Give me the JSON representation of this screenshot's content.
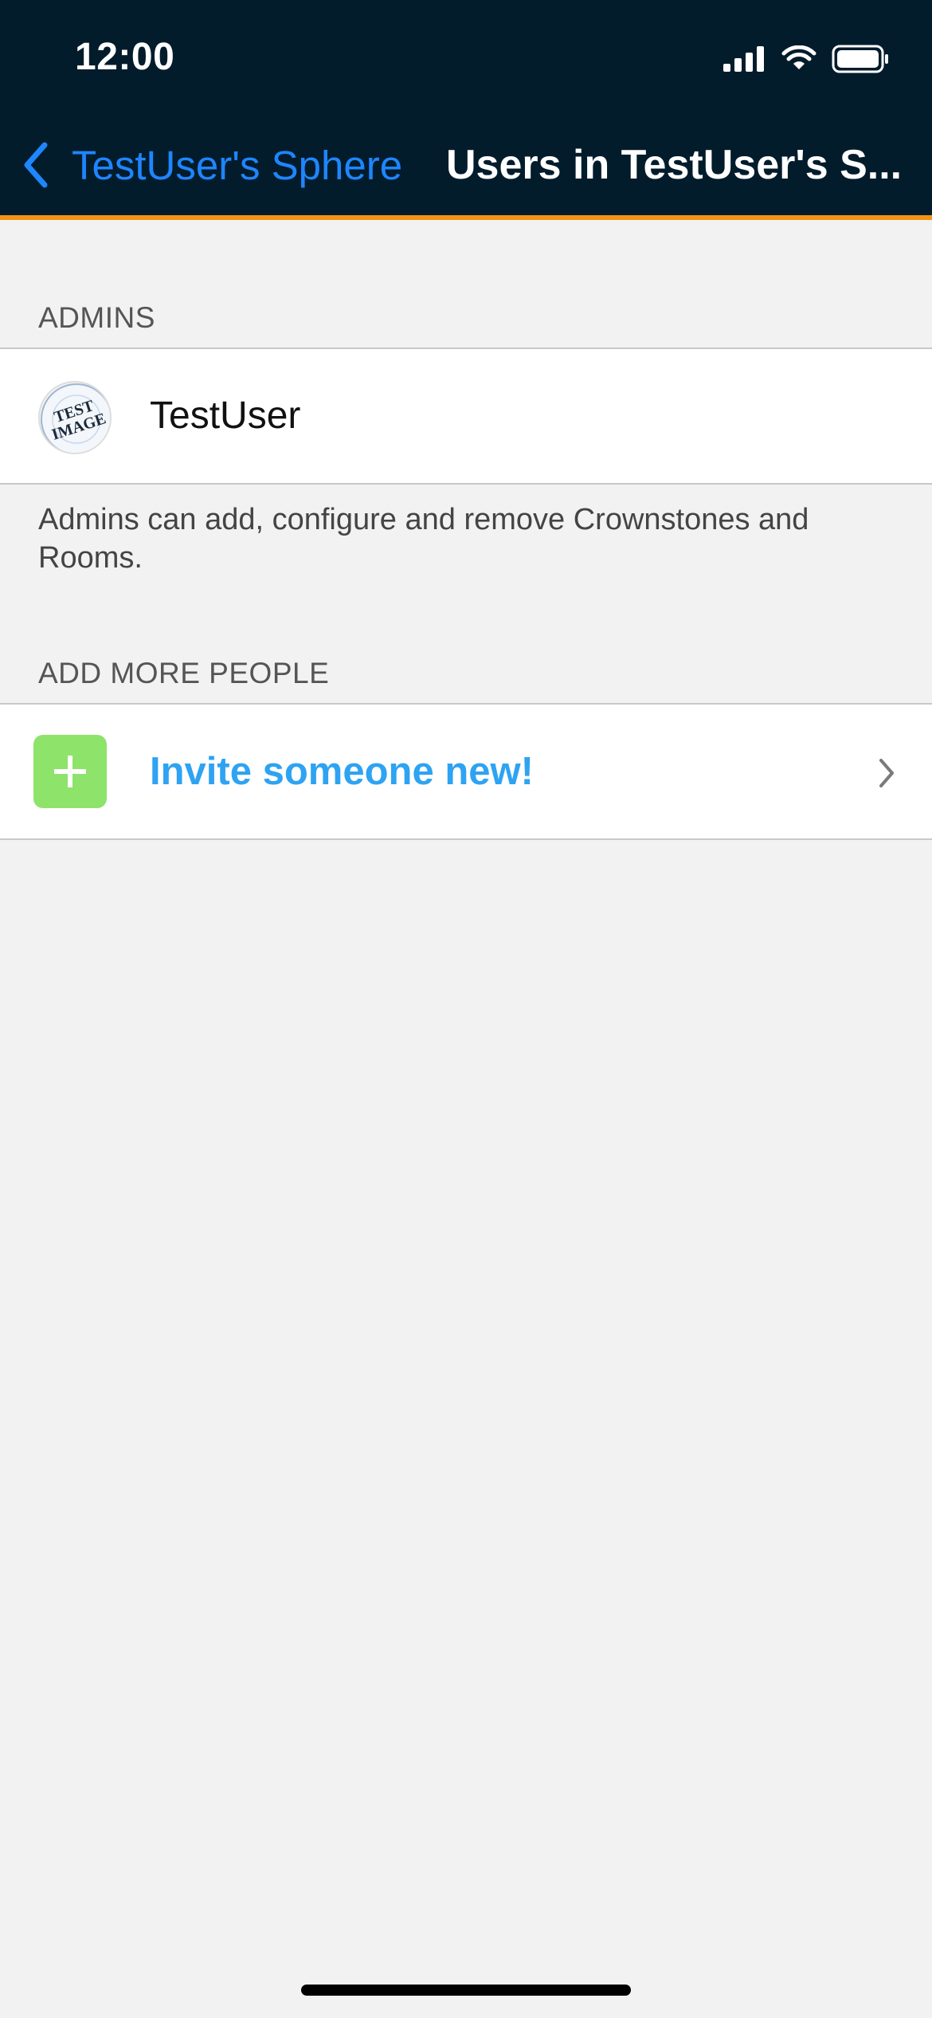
{
  "status_bar": {
    "time": "12:00"
  },
  "nav": {
    "back_label": "TestUser's Sphere",
    "title": "Users in TestUser's S..."
  },
  "admins_section": {
    "header": "ADMINS",
    "users": [
      {
        "name": "TestUser",
        "avatar_text": [
          "TEST",
          "IMAGE"
        ]
      }
    ],
    "footnote": "Admins can add, configure and remove Crownstones and Rooms."
  },
  "add_section": {
    "header": "ADD MORE PEOPLE",
    "invite_label": "Invite someone new!"
  },
  "colors": {
    "header_bg": "#031c2c",
    "accent_orange": "#f39412",
    "link_blue": "#1e86ff",
    "invite_text": "#2ea3f2",
    "invite_icon_bg": "#8ee36b"
  }
}
